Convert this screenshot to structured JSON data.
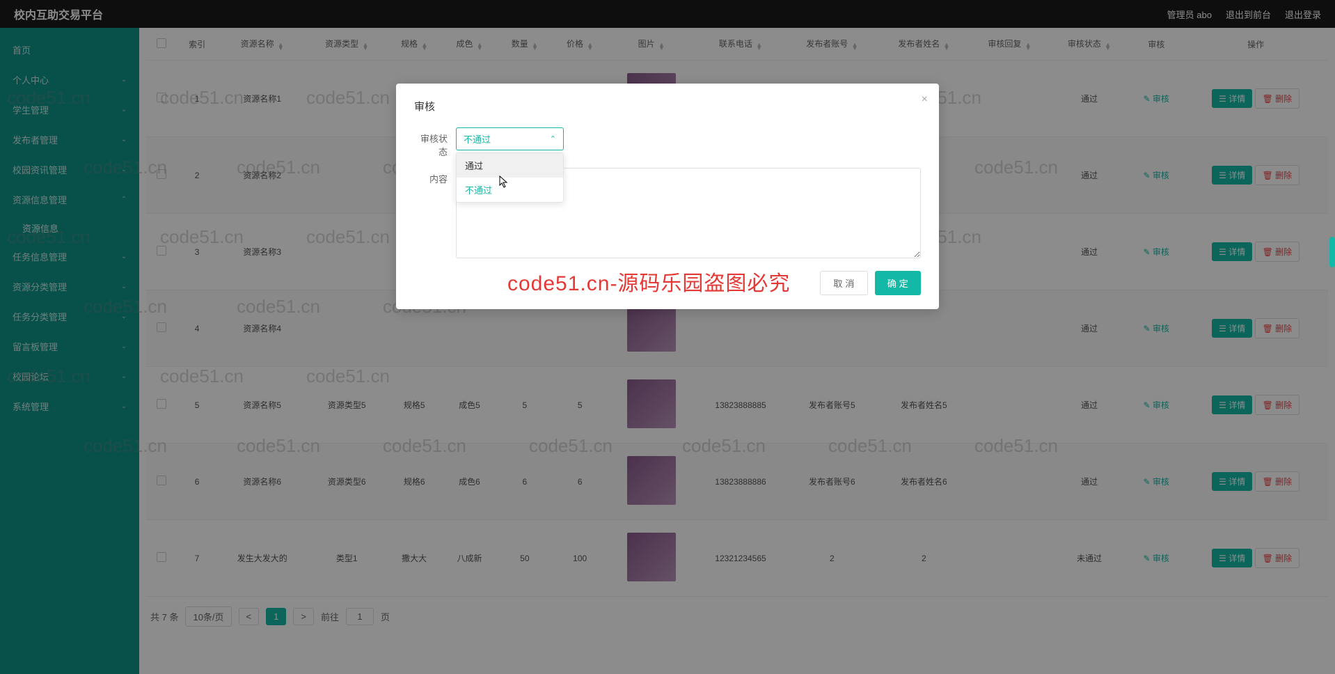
{
  "brand": "校内互助交易平台",
  "top_admin": "管理员 abo",
  "top_exit_front": "退出到前台",
  "top_logout": "退出登录",
  "sidebar": {
    "items": [
      {
        "label": "首页",
        "expand": false
      },
      {
        "label": "个人中心",
        "expand": true
      },
      {
        "label": "学生管理",
        "expand": true
      },
      {
        "label": "发布者管理",
        "expand": true
      },
      {
        "label": "校园资讯管理",
        "expand": true
      },
      {
        "label": "资源信息管理",
        "expand": true,
        "open": true
      },
      {
        "label": "任务信息管理",
        "expand": true
      },
      {
        "label": "资源分类管理",
        "expand": true
      },
      {
        "label": "任务分类管理",
        "expand": true
      },
      {
        "label": "留言板管理",
        "expand": true
      },
      {
        "label": "校园论坛",
        "expand": true
      },
      {
        "label": "系统管理",
        "expand": true
      }
    ],
    "sub_resource": "资源信息"
  },
  "table": {
    "headers": [
      "索引",
      "资源名称",
      "资源类型",
      "规格",
      "成色",
      "数量",
      "价格",
      "图片",
      "联系电话",
      "发布者账号",
      "发布者姓名",
      "审核回复",
      "审核状态",
      "审核",
      "操作"
    ],
    "rows": [
      {
        "idx": "1",
        "name": "资源名称1",
        "type": "",
        "spec": "",
        "cond": "",
        "qty": "",
        "price": "",
        "phone": "",
        "pub_acc": "",
        "pub_name": "",
        "reply": "",
        "status": "通过"
      },
      {
        "idx": "2",
        "name": "资源名称2",
        "type": "",
        "spec": "",
        "cond": "",
        "qty": "",
        "price": "",
        "phone": "",
        "pub_acc": "",
        "pub_name": "",
        "reply": "",
        "status": "通过"
      },
      {
        "idx": "3",
        "name": "资源名称3",
        "type": "",
        "spec": "",
        "cond": "",
        "qty": "",
        "price": "",
        "phone": "",
        "pub_acc": "",
        "pub_name": "",
        "reply": "",
        "status": "通过"
      },
      {
        "idx": "4",
        "name": "资源名称4",
        "type": "",
        "spec": "",
        "cond": "",
        "qty": "",
        "price": "",
        "phone": "",
        "pub_acc": "",
        "pub_name": "",
        "reply": "",
        "status": "通过"
      },
      {
        "idx": "5",
        "name": "资源名称5",
        "type": "资源类型5",
        "spec": "规格5",
        "cond": "成色5",
        "qty": "5",
        "price": "5",
        "phone": "13823888885",
        "pub_acc": "发布者账号5",
        "pub_name": "发布者姓名5",
        "reply": "",
        "status": "通过"
      },
      {
        "idx": "6",
        "name": "资源名称6",
        "type": "资源类型6",
        "spec": "规格6",
        "cond": "成色6",
        "qty": "6",
        "price": "6",
        "phone": "13823888886",
        "pub_acc": "发布者账号6",
        "pub_name": "发布者姓名6",
        "reply": "",
        "status": "通过"
      },
      {
        "idx": "7",
        "name": "发生大发大的",
        "type": "类型1",
        "spec": "撒大大",
        "cond": "八成新",
        "qty": "50",
        "price": "100",
        "phone": "12321234565",
        "pub_acc": "2",
        "pub_name": "2",
        "reply": "",
        "status": "未通过"
      }
    ],
    "audit_link": "审核",
    "btn_detail": "详情",
    "btn_delete": "删除"
  },
  "pager": {
    "total": "共 7 条",
    "page_size": "10条/页",
    "prev": "<",
    "cur": "1",
    "next": ">",
    "goto": "前往",
    "page_unit": "页",
    "page_input": "1"
  },
  "modal": {
    "title": "审核",
    "label_status": "审核状态",
    "label_content": "内容",
    "select_value": "不通过",
    "options": {
      "pass": "通过",
      "fail": "不通过"
    },
    "cancel": "取 消",
    "ok": "确 定"
  },
  "watermark_text": "code51.cn",
  "watermark_big": "code51.cn-源码乐园盗图必究"
}
